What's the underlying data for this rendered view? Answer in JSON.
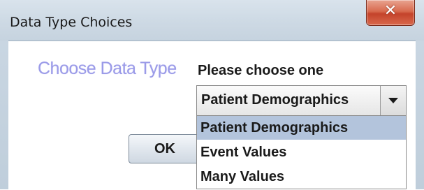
{
  "window": {
    "title": "Data Type Choices",
    "close_label": "✕"
  },
  "content": {
    "heading": "Choose Data Type",
    "prompt": "Please choose one",
    "ok_label": "OK"
  },
  "combo": {
    "selected": "Patient Demographics",
    "options": [
      "Patient Demographics",
      "Event Values",
      "Many Values"
    ],
    "highlighted_index": 0
  },
  "colors": {
    "heading": "#9b9be8",
    "close_button": "#d86a4e",
    "selection": "#b3c4dc"
  }
}
